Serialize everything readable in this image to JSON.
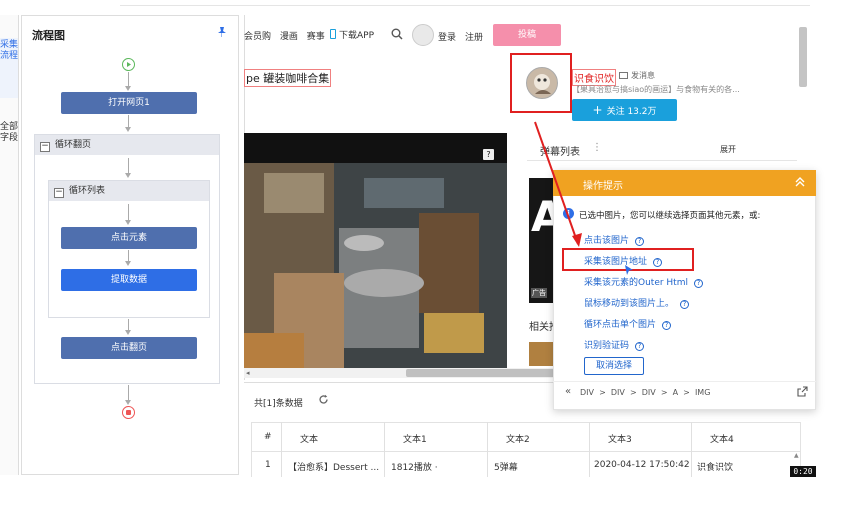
{
  "sidebar_tabs": [
    "采集流程",
    "全部字段"
  ],
  "flow_panel": {
    "title": "流程图",
    "nodes": {
      "open_page": "打开网页1",
      "loop_page": "循环翻页",
      "loop_list": "循环列表",
      "click_element": "点击元素",
      "extract_data": "提取数据",
      "click_next": "点击翻页"
    }
  },
  "site": {
    "nav": [
      "会员购",
      "漫画",
      "赛事",
      "下载APP"
    ],
    "login": "登录",
    "register": "注册",
    "upload": "投稿",
    "video_title": "pe 罐装咖啡合集",
    "uploader_name": "识食识饮",
    "message": "发消息",
    "uploader_desc": "【果具治愈与搞siao的画运】与食物有关的各...",
    "follow": "关注 13.2万",
    "danmaku": "弹幕列表",
    "expand": "展开",
    "related": "相关推",
    "ad_tag": "广告",
    "ad_letter": "A"
  },
  "popup": {
    "title": "操作提示",
    "info": "已选中图片，您可以继续选择页面其他元素，或:",
    "links": [
      "点击该图片",
      "采集该图片地址",
      "采集该元素的Outer Html",
      "鼠标移动到该图片上。",
      "循环点击单个图片",
      "识别验证码"
    ],
    "cancel": "取消选择",
    "path": "DIV  >  DIV  >  DIV  >  A  >  IMG"
  },
  "data_table": {
    "count_label": "共[1]条数据",
    "headers": [
      "#",
      "文本",
      "文本1",
      "文本2",
      "文本3",
      "文本4"
    ],
    "rows": [
      [
        "1",
        "【治愈系】Dessert ...",
        "1812播放 ·",
        "5弹幕",
        "2020-04-12 17:50:42",
        "识食识饮"
      ]
    ]
  },
  "timer": "0:20",
  "colors": {
    "accent_blue": "#2e6ee6",
    "node_dark": "#4f6fae",
    "popup_orange": "#f0a221",
    "upload_pink": "#f58fab",
    "follow_blue": "#1aa0dc",
    "highlight_red": "#e02020"
  }
}
